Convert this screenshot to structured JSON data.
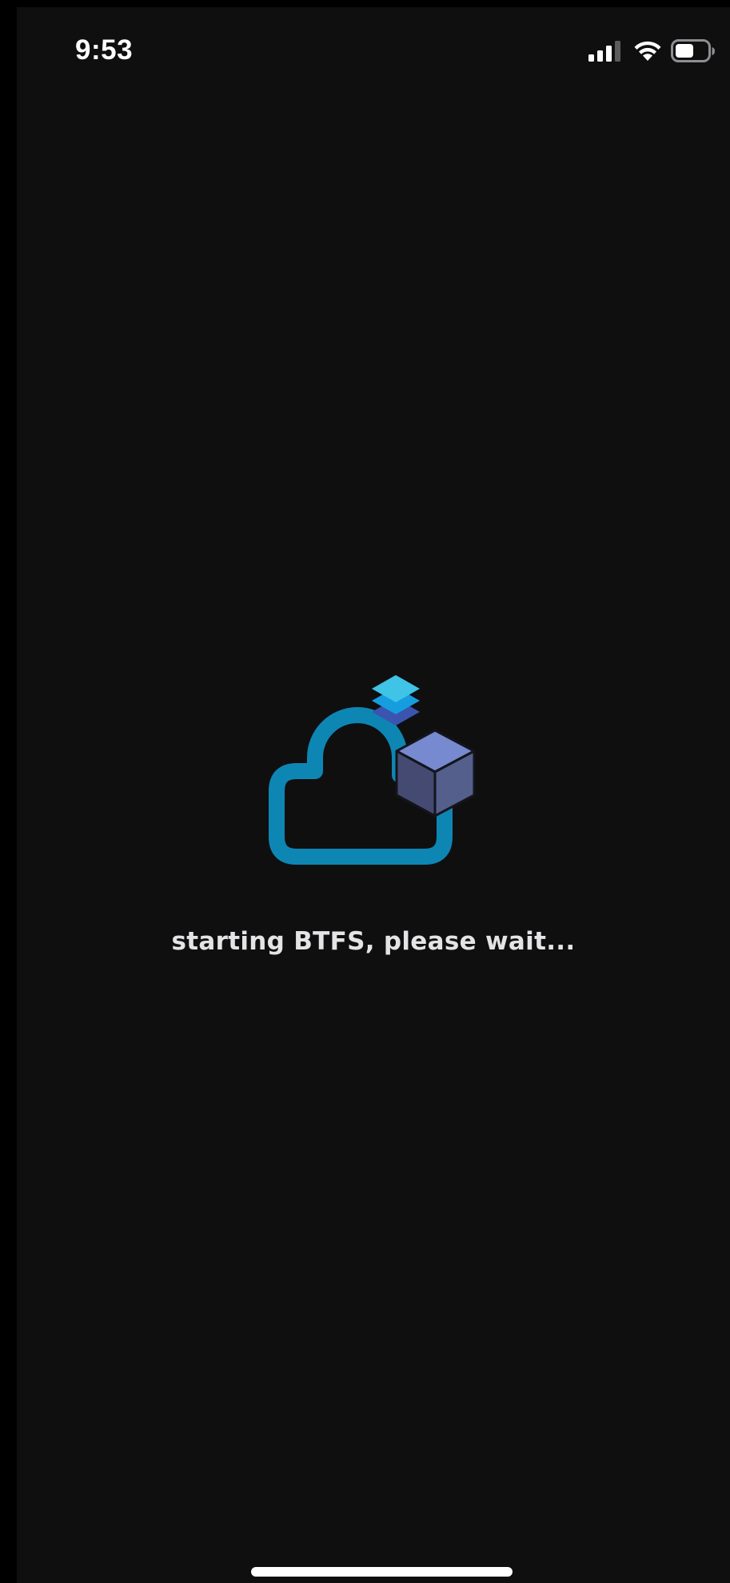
{
  "status_bar": {
    "time": "9:53",
    "icons": [
      "cellular-signal-icon",
      "wifi-icon",
      "battery-icon"
    ]
  },
  "logo": {
    "name": "btfs-cloud-logo",
    "colors": {
      "cloud": "#0e86b4",
      "layer_top": "#3fc3e6",
      "layer_mid": "#169ddf",
      "layer_bottom": "#3a54b0",
      "cube_top": "#7789cf",
      "cube_left": "#454a72",
      "cube_right": "#555f8c"
    }
  },
  "message": "starting BTFS, please wait..."
}
